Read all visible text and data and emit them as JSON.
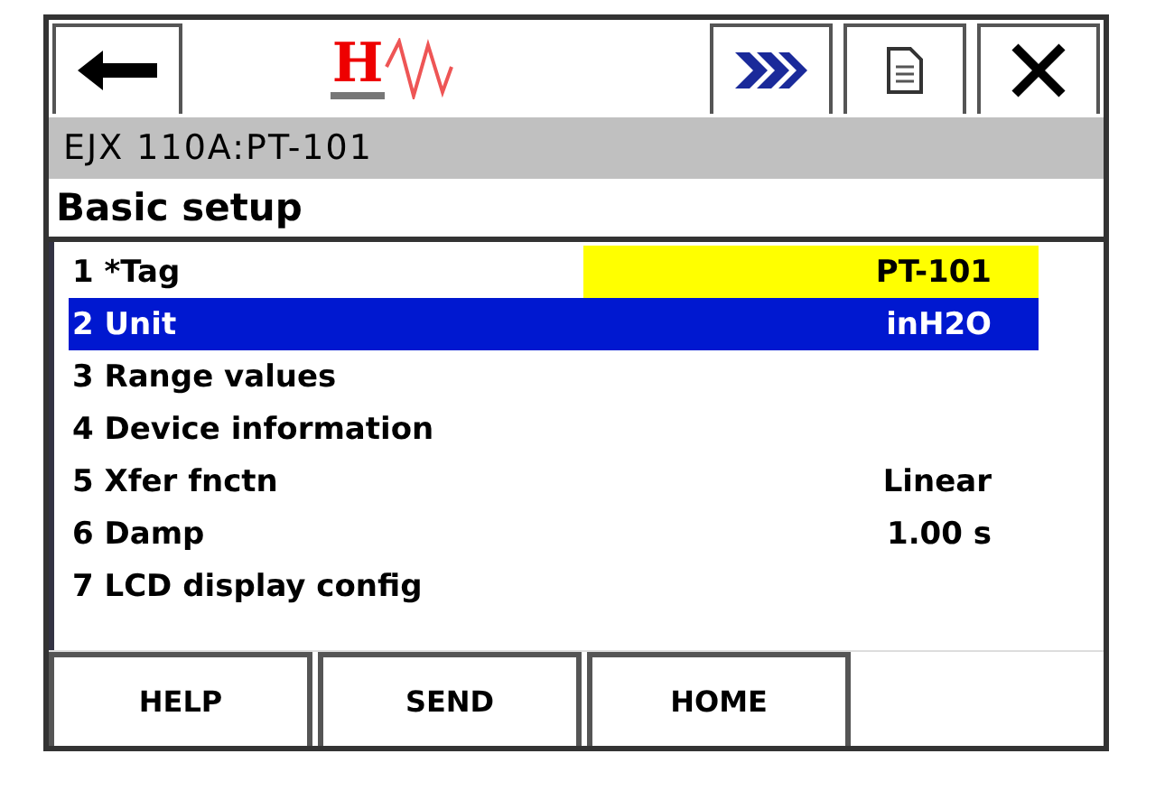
{
  "logo_letter": "H",
  "device_title": "EJX 110A:PT-101",
  "menu_title": "Basic setup",
  "items": [
    {
      "label": "1 *Tag",
      "value": "PT-101",
      "selected": false,
      "highlighted": true
    },
    {
      "label": "2 Unit",
      "value": "inH2O",
      "selected": true,
      "highlighted": false
    },
    {
      "label": "3 Range values",
      "selected": false,
      "highlighted": false
    },
    {
      "label": "4 Device information",
      "selected": false,
      "highlighted": false
    },
    {
      "label": "5 Xfer fnctn",
      "value": "Linear",
      "selected": false,
      "highlighted": false
    },
    {
      "label": "6 Damp",
      "value": "1.00 s",
      "selected": false,
      "highlighted": false
    },
    {
      "label": "7 LCD display config",
      "selected": false,
      "highlighted": false
    }
  ],
  "softkeys": [
    "HELP",
    "SEND",
    "HOME"
  ]
}
